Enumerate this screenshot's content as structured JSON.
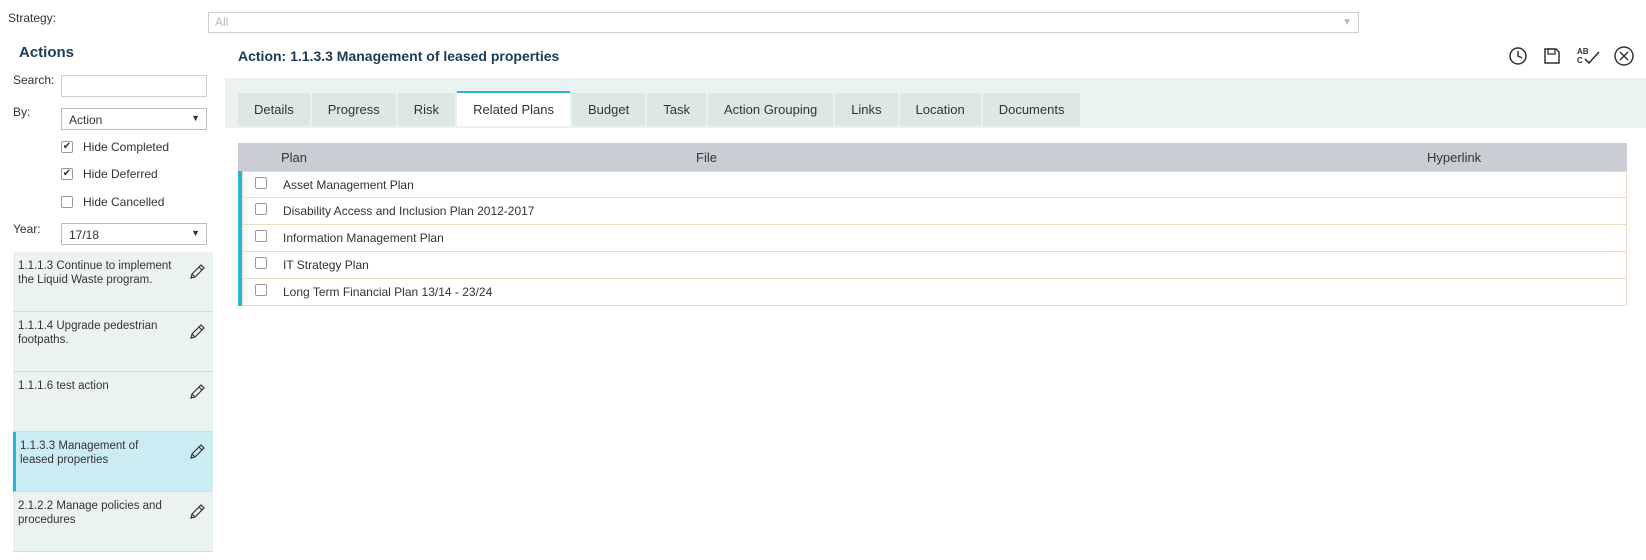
{
  "strategy": {
    "label": "Strategy:",
    "value": "All"
  },
  "sidebar": {
    "title": "Actions",
    "search_label": "Search:",
    "search_value": "",
    "by_label": "By:",
    "by_value": "Action",
    "filters": [
      {
        "label": "Hide Completed",
        "checked": true
      },
      {
        "label": "Hide Deferred",
        "checked": true
      },
      {
        "label": "Hide Cancelled",
        "checked": false
      }
    ],
    "year_label": "Year:",
    "year_value": "17/18",
    "items": [
      {
        "label": "1.1.1.3 Continue to implement the Liquid Waste program.",
        "selected": false
      },
      {
        "label": "1.1.1.4 Upgrade pedestrian footpaths.",
        "selected": false
      },
      {
        "label": "1.1.1.6 test action",
        "selected": false
      },
      {
        "label": "1.1.3.3 Management of leased properties",
        "selected": true
      },
      {
        "label": "2.1.2.2 Manage policies and procedures",
        "selected": false
      }
    ]
  },
  "main": {
    "title": "Action: 1.1.3.3 Management of leased properties",
    "toolbar": [
      "history-icon",
      "save-icon",
      "spellcheck-icon",
      "close-icon"
    ],
    "tabs": [
      {
        "label": "Details",
        "active": false
      },
      {
        "label": "Progress",
        "active": false
      },
      {
        "label": "Risk",
        "active": false
      },
      {
        "label": "Related Plans",
        "active": true
      },
      {
        "label": "Budget",
        "active": false
      },
      {
        "label": "Task",
        "active": false
      },
      {
        "label": "Action Grouping",
        "active": false
      },
      {
        "label": "Links",
        "active": false
      },
      {
        "label": "Location",
        "active": false
      },
      {
        "label": "Documents",
        "active": false
      }
    ],
    "table": {
      "columns": [
        "Plan",
        "File",
        "Hyperlink"
      ],
      "rows": [
        {
          "plan": "Asset Management Plan",
          "file": "",
          "hyperlink": ""
        },
        {
          "plan": "Disability Access and Inclusion Plan 2012-2017",
          "file": "",
          "hyperlink": ""
        },
        {
          "plan": "Information Management Plan",
          "file": "",
          "hyperlink": ""
        },
        {
          "plan": "IT Strategy Plan",
          "file": "",
          "hyperlink": ""
        },
        {
          "plan": "Long Term Financial Plan 13/14 - 23/24",
          "file": "",
          "hyperlink": ""
        }
      ]
    }
  },
  "colors": {
    "accent": "#27b6d3",
    "title": "#1b3a57",
    "panel": "#ebf3f2",
    "header": "#cacdd3"
  }
}
